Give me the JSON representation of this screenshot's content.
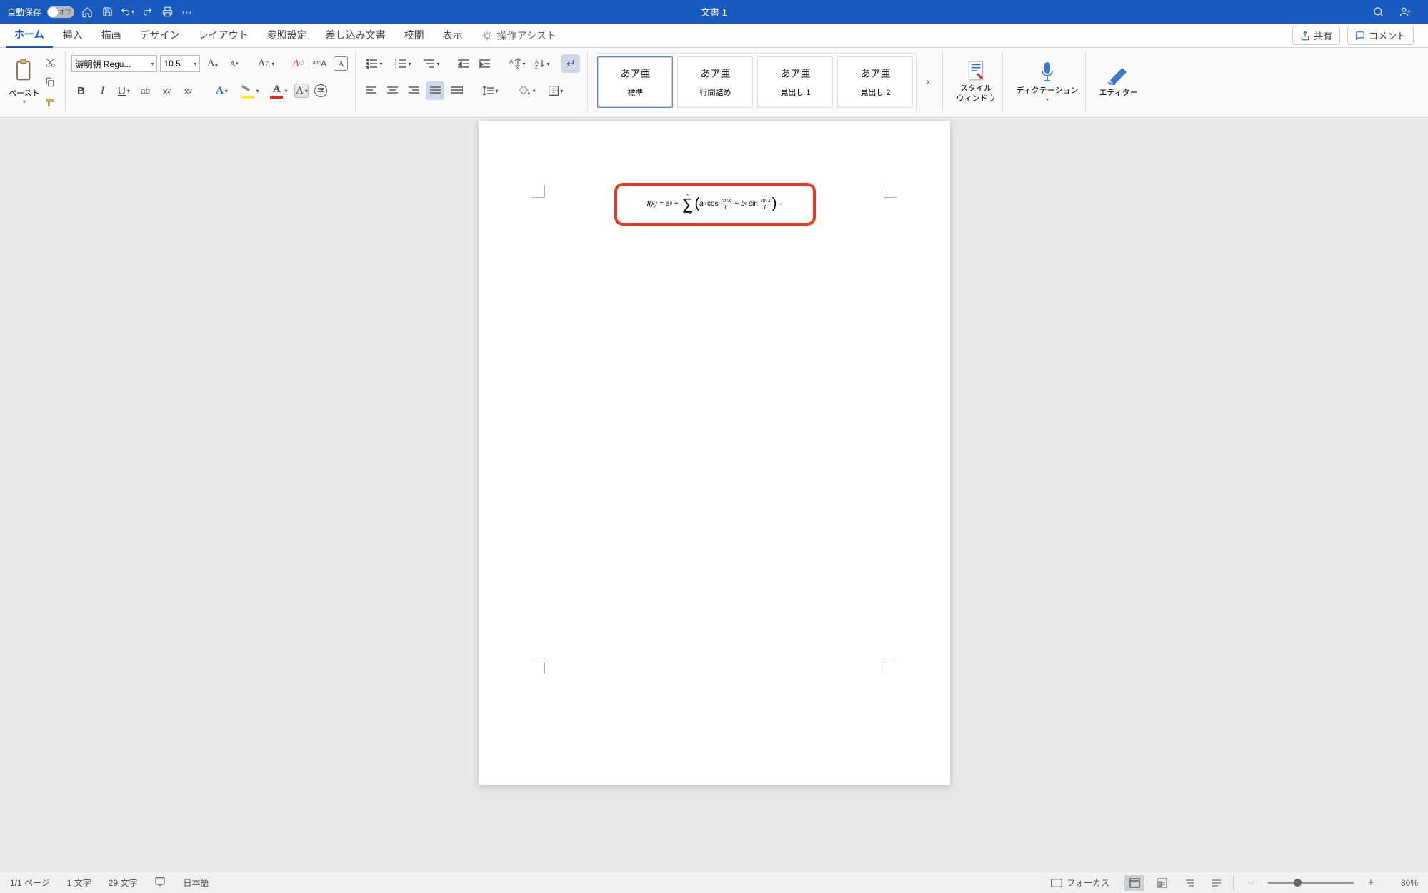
{
  "titlebar": {
    "autosave_label": "自動保存",
    "autosave_state": "オフ",
    "document_title": "文書 1"
  },
  "tabs": {
    "items": [
      "ホーム",
      "挿入",
      "描画",
      "デザイン",
      "レイアウト",
      "参照設定",
      "差し込み文書",
      "校閲",
      "表示"
    ],
    "active_index": 0,
    "assist_label": "操作アシスト",
    "share_label": "共有",
    "comment_label": "コメント"
  },
  "ribbon": {
    "paste_label": "ペースト",
    "font_name": "游明朝 Regu...",
    "font_size": "10.5",
    "styles": [
      {
        "sample": "あア亜",
        "label": "標準",
        "selected": true
      },
      {
        "sample": "あア亜",
        "label": "行間詰め",
        "selected": false
      },
      {
        "sample": "あア亜",
        "label": "見出し 1",
        "selected": false
      },
      {
        "sample": "あア亜",
        "label": "見出し 2",
        "selected": false
      }
    ],
    "style_window_label": "スタイル\nウィンドウ",
    "dictation_label": "ディクテーション",
    "editor_label": "エディター"
  },
  "document": {
    "equation": {
      "lhs": "f(x)",
      "a0": "a",
      "a0_sub": "0",
      "sum_lower": "n=1",
      "sum_upper": "∞",
      "an": "a",
      "an_sub": "n",
      "cos": "cos",
      "frac1_num": "nπx",
      "frac1_den": "L",
      "bn": "b",
      "bn_sub": "n",
      "sin": "sin",
      "frac2_num": "nπx",
      "frac2_den": "L"
    }
  },
  "statusbar": {
    "page_info": "1/1 ページ",
    "word_count1": "1 文字",
    "word_count2": "29 文字",
    "language": "日本語",
    "focus_label": "フォーカス",
    "zoom_percent": "80%"
  }
}
